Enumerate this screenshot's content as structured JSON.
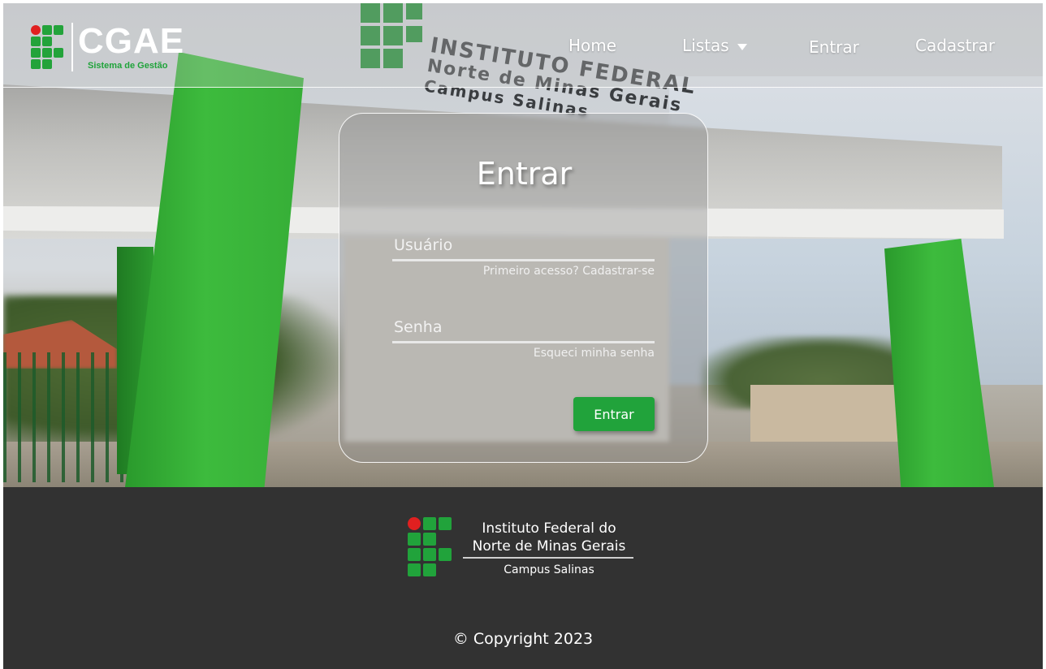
{
  "header": {
    "brand": "CGAE",
    "tagline": "Sistema de Gestão",
    "nav": {
      "home": "Home",
      "listas": "Listas",
      "entrar": "Entrar",
      "cadastrar": "Cadastrar"
    }
  },
  "background": {
    "sign_line1": "INSTITUTO FEDERAL",
    "sign_line2": "Norte de Minas Gerais",
    "sign_line3": "Campus Salinas"
  },
  "login": {
    "title": "Entrar",
    "username_placeholder": "Usuário",
    "signup_link": "Primeiro acesso? Cadastrar-se",
    "password_placeholder": "Senha",
    "forgot_link": "Esqueci minha senha",
    "submit_label": "Entrar"
  },
  "footer": {
    "institution_line1": "Instituto Federal do",
    "institution_line2": "Norte de Minas Gerais",
    "campus": "Campus Salinas",
    "copyright": "© Copyright 2023"
  },
  "colors": {
    "brand_green": "#21a33b",
    "logo_red": "#e02020",
    "footer_bg": "#323232"
  },
  "icons": {
    "dropdown": "caret-down-icon",
    "logo_mark": "if-logo-icon"
  }
}
